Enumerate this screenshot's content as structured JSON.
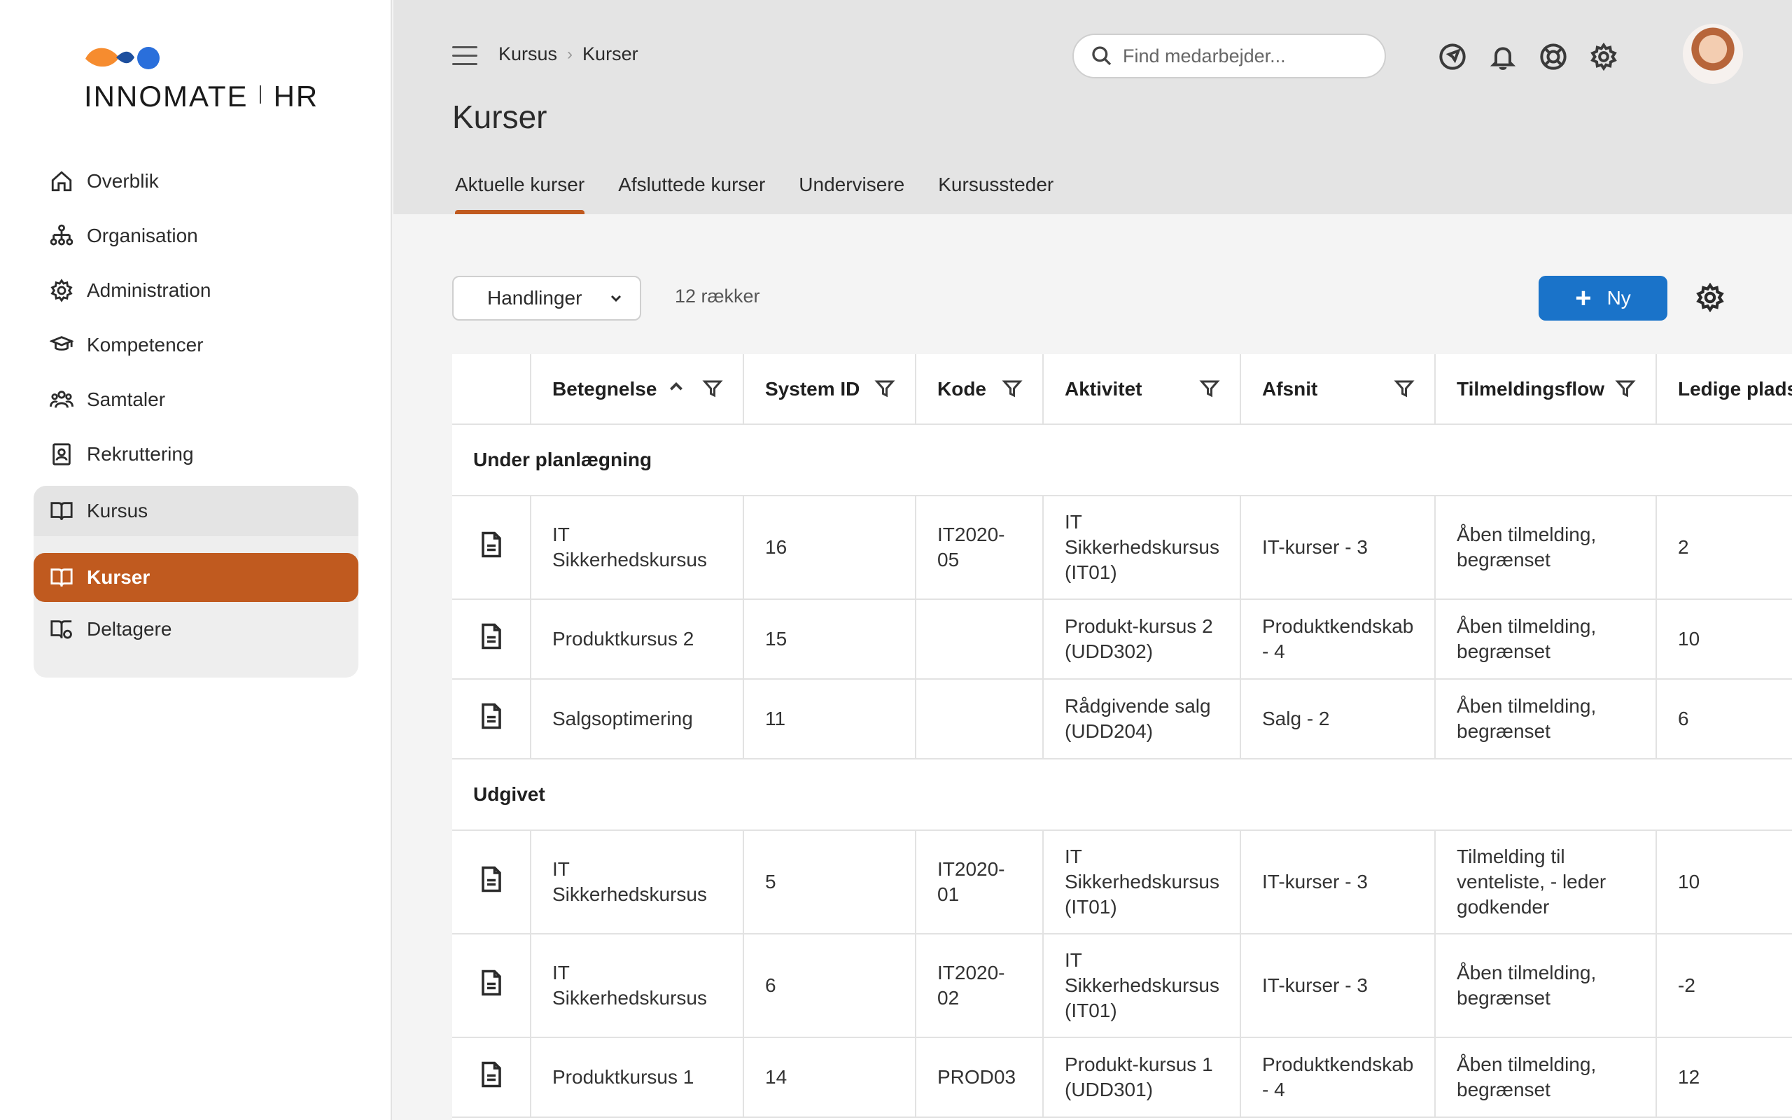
{
  "logo": {
    "name": "INNOMATE",
    "product": "HR",
    "colors": {
      "orange": "#f68c2f",
      "blue": "#2a6fdb"
    }
  },
  "sidebar": {
    "items": [
      {
        "label": "Overblik",
        "icon": "home-icon"
      },
      {
        "label": "Organisation",
        "icon": "org-chart-icon"
      },
      {
        "label": "Administration",
        "icon": "gear-icon"
      },
      {
        "label": "Kompetencer",
        "icon": "graduation-cap-icon"
      },
      {
        "label": "Samtaler",
        "icon": "people-icon"
      },
      {
        "label": "Rekruttering",
        "icon": "id-badge-icon"
      }
    ],
    "group": {
      "label": "Kursus",
      "icon": "open-book-icon",
      "children": [
        {
          "label": "Kurser",
          "icon": "open-book-icon",
          "active": true
        },
        {
          "label": "Deltagere",
          "icon": "book-user-icon",
          "active": false
        }
      ]
    }
  },
  "header": {
    "breadcrumb": [
      "Kursus",
      "Kurser"
    ],
    "title": "Kurser",
    "search_placeholder": "Find medarbejder...",
    "icons": [
      "navigate-icon",
      "bell-icon",
      "lifebuoy-icon",
      "gear-icon"
    ],
    "tabs": [
      {
        "label": "Aktuelle kurser",
        "active": true
      },
      {
        "label": "Afsluttede kurser",
        "active": false
      },
      {
        "label": "Undervisere",
        "active": false
      },
      {
        "label": "Kursussteder",
        "active": false
      }
    ]
  },
  "toolbar": {
    "actions_label": "Handlinger",
    "row_count": "12 rækker",
    "new_label": "Ny",
    "accent": "#1a73c9"
  },
  "table": {
    "columns": [
      "Betegnelse",
      "System ID",
      "Kode",
      "Aktivitet",
      "Afsnit",
      "Tilmeldingsflow",
      "Ledige pladser"
    ],
    "groups": [
      {
        "name": "Under planlægning",
        "rows": [
          [
            "IT Sikkerhedskursus",
            "16",
            "IT2020-05",
            "IT Sikkerhedskursus (IT01)",
            "IT-kurser - 3",
            "Åben tilmelding, begrænset",
            "2"
          ],
          [
            "Produktkursus 2",
            "15",
            "",
            "Produkt-kursus 2 (UDD302)",
            "Produktkendskab - 4",
            "Åben tilmelding, begrænset",
            "10"
          ],
          [
            "Salgsoptimering",
            "11",
            "",
            "Rådgivende salg (UDD204)",
            "Salg - 2",
            "Åben tilmelding, begrænset",
            "6"
          ]
        ]
      },
      {
        "name": "Udgivet",
        "rows": [
          [
            "IT Sikkerhedskursus",
            "5",
            "IT2020-01",
            "IT Sikkerhedskursus (IT01)",
            "IT-kurser - 3",
            "Tilmelding til venteliste, - leder godkender",
            "10"
          ],
          [
            "IT Sikkerhedskursus",
            "6",
            "IT2020-02",
            "IT Sikkerhedskursus (IT01)",
            "IT-kurser - 3",
            "Åben tilmelding, begrænset",
            "-2"
          ],
          [
            "Produktkursus 1",
            "14",
            "PROD03",
            "Produkt-kursus 1 (UDD301)",
            "Produktkendskab - 4",
            "Åben tilmelding, begrænset",
            "12"
          ]
        ]
      }
    ]
  }
}
